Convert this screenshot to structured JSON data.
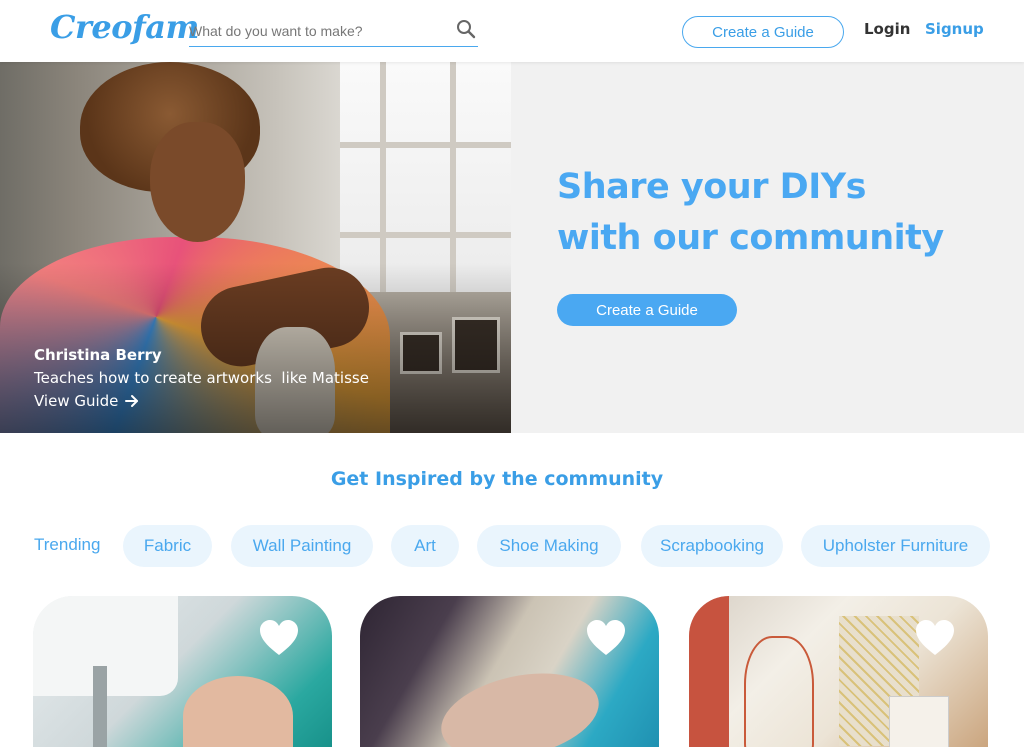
{
  "header": {
    "logo": "Creofam",
    "search_placeholder": "What do you want to make?",
    "create_guide": "Create a Guide",
    "login": "Login",
    "signup": "Signup"
  },
  "hero": {
    "author": "Christina Berry",
    "description": "Teaches how to create artworks  like Matisse",
    "link": "View Guide",
    "title_line1": "Share your DIYs",
    "title_line2": "with our community",
    "cta": "Create a Guide"
  },
  "inspired": {
    "title": "Get Inspired by the community",
    "trending_label": "Trending",
    "chips": [
      "Fabric",
      "Wall Painting",
      "Art",
      "Shoe Making",
      "Scrapbooking",
      "Upholster Furniture"
    ]
  },
  "cards": [
    {
      "icon": "heart-icon"
    },
    {
      "icon": "heart-icon"
    },
    {
      "icon": "heart-icon"
    }
  ],
  "colors": {
    "accent": "#4aa8f2",
    "hero_bg": "#f1f1f1",
    "chip_bg": "#eaf5fd"
  }
}
